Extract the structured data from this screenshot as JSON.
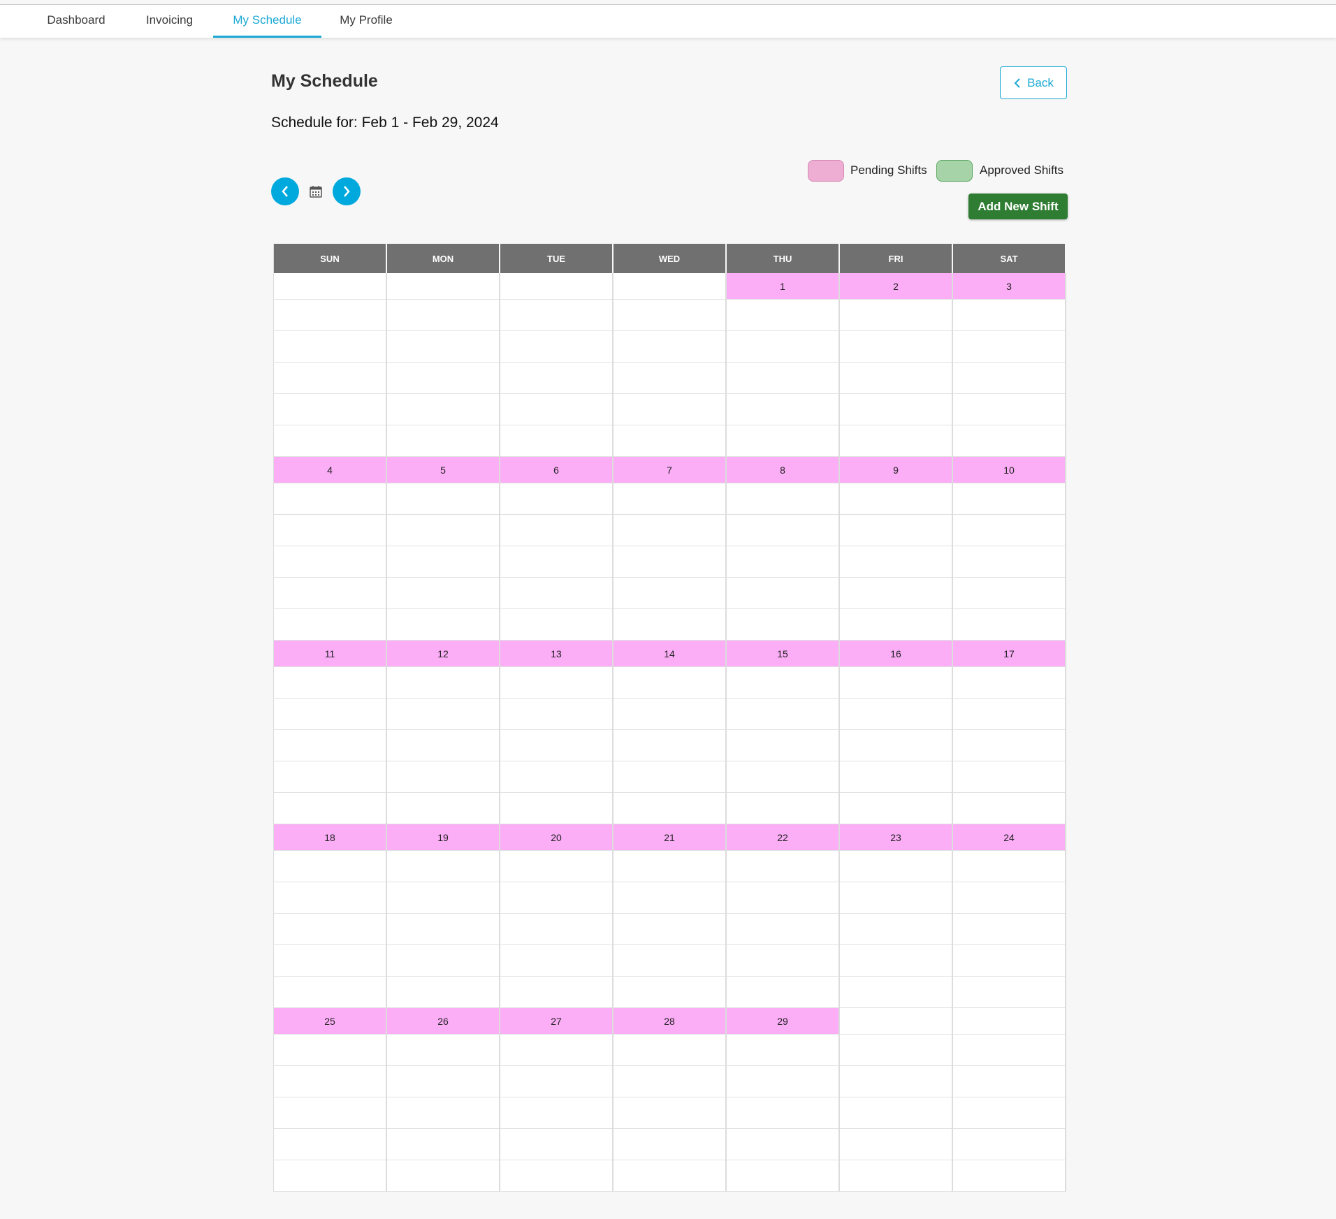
{
  "nav": {
    "tabs": [
      {
        "label": "Dashboard",
        "active": false
      },
      {
        "label": "Invoicing",
        "active": false
      },
      {
        "label": "My Schedule",
        "active": true
      },
      {
        "label": "My Profile",
        "active": false
      }
    ]
  },
  "page": {
    "title": "My Schedule",
    "schedule_for": "Schedule for: Feb 1 - Feb 29, 2024",
    "back_label": "Back",
    "add_shift_label": "Add New Shift"
  },
  "legend": {
    "pending": {
      "label": "Pending Shifts",
      "color": "#eeaed3"
    },
    "approved": {
      "label": "Approved Shifts",
      "color": "#a6d4a8"
    }
  },
  "colors": {
    "accent": "#1aa8d4",
    "nav_button": "#00a9dd",
    "add_button": "#2e7d32",
    "day_header": "#fbadf6",
    "weekday_header": "#707070"
  },
  "calendar": {
    "weekdays": [
      "SUN",
      "MON",
      "TUE",
      "WED",
      "THU",
      "FRI",
      "SAT"
    ],
    "weeks": [
      [
        "",
        "",
        "",
        "",
        "1",
        "2",
        "3"
      ],
      [
        "4",
        "5",
        "6",
        "7",
        "8",
        "9",
        "10"
      ],
      [
        "11",
        "12",
        "13",
        "14",
        "15",
        "16",
        "17"
      ],
      [
        "18",
        "19",
        "20",
        "21",
        "22",
        "23",
        "24"
      ],
      [
        "25",
        "26",
        "27",
        "28",
        "29",
        "",
        ""
      ]
    ],
    "slots_per_day": 5
  }
}
